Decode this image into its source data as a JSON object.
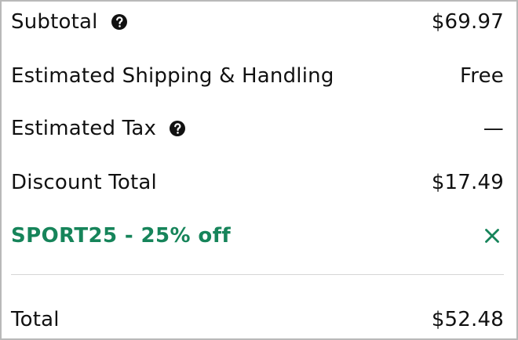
{
  "summary": {
    "subtotal": {
      "label": "Subtotal",
      "value": "$69.97",
      "help_icon": "question-circle-icon"
    },
    "shipping": {
      "label": "Estimated Shipping & Handling",
      "value": "Free"
    },
    "tax": {
      "label": "Estimated Tax",
      "value": "—",
      "help_icon": "question-circle-icon"
    },
    "discount": {
      "label": "Discount Total",
      "value": "$17.49"
    },
    "promo": {
      "label": "SPORT25 - 25% off",
      "remove_icon": "close-icon",
      "color": "#16845a"
    },
    "total": {
      "label": "Total",
      "value": "$52.48"
    }
  }
}
